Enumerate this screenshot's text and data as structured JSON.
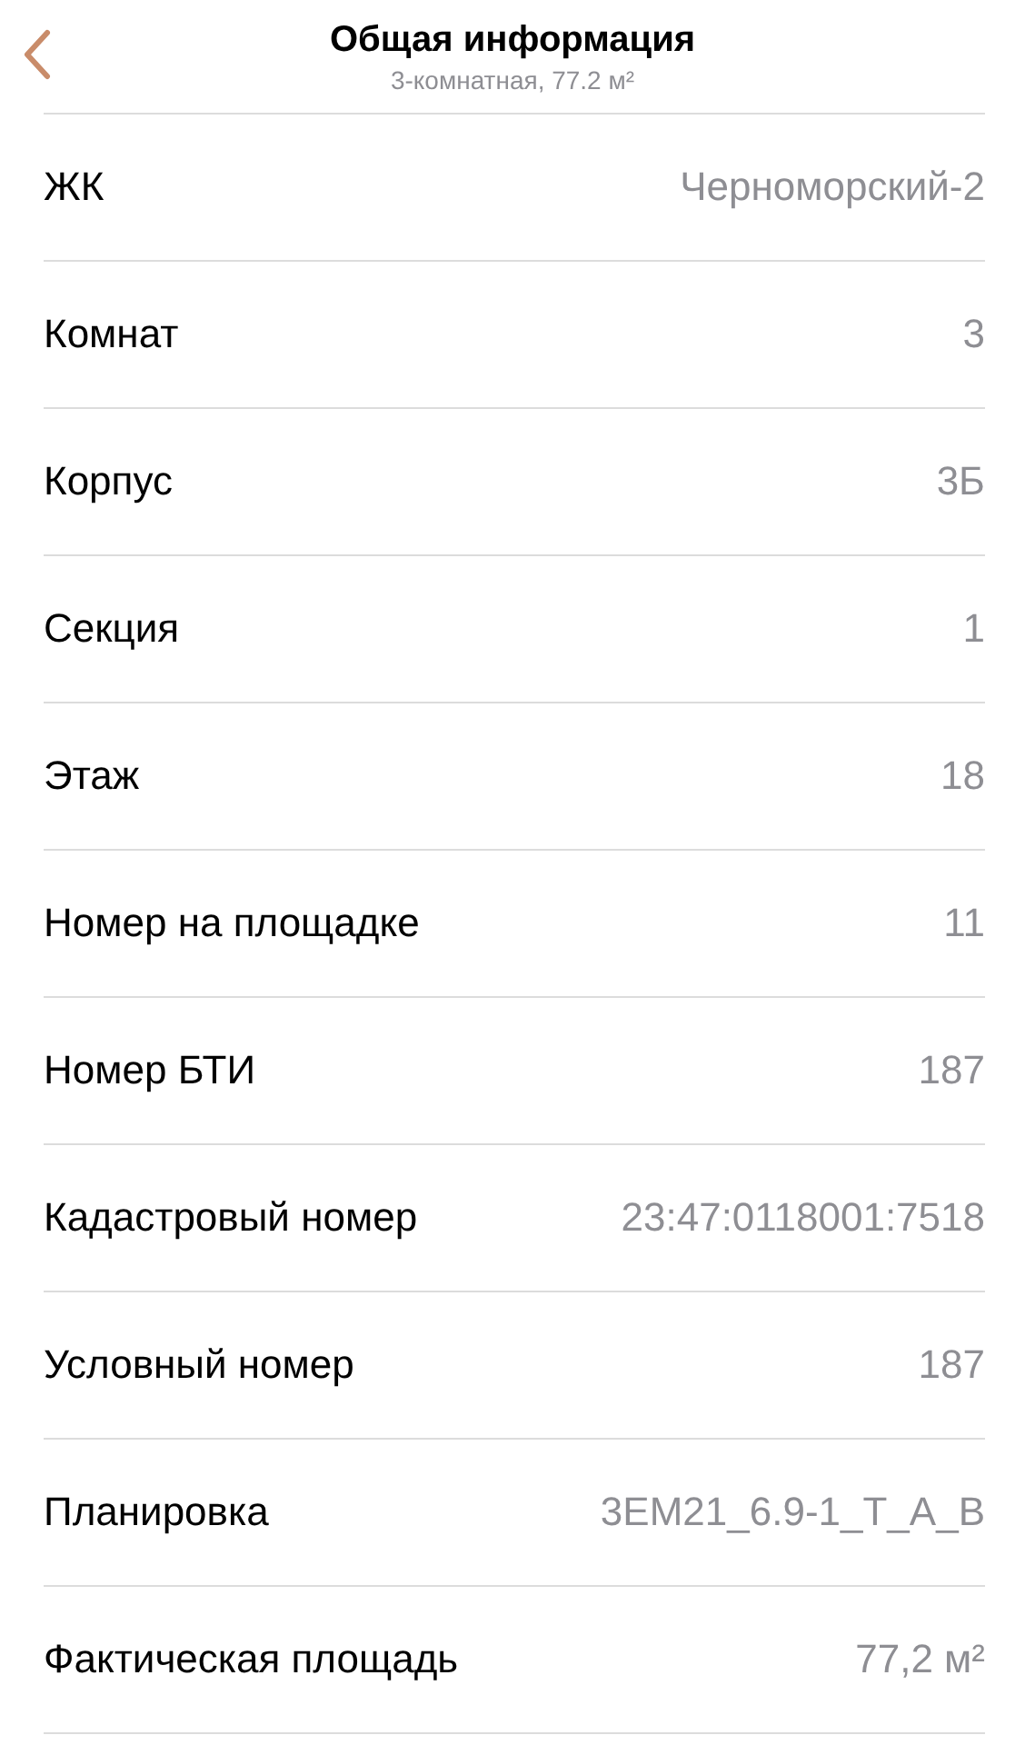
{
  "header": {
    "title": "Общая информация",
    "subtitle": "3-комнатная, 77.2 м²"
  },
  "rows": [
    {
      "label": "ЖК",
      "value": "Черноморский-2"
    },
    {
      "label": "Комнат",
      "value": "3"
    },
    {
      "label": "Корпус",
      "value": "3Б"
    },
    {
      "label": "Секция",
      "value": "1"
    },
    {
      "label": "Этаж",
      "value": "18"
    },
    {
      "label": "Номер на площадке",
      "value": "11"
    },
    {
      "label": "Номер БТИ",
      "value": "187"
    },
    {
      "label": "Кадастровый номер",
      "value": "23:47:0118001:7518"
    },
    {
      "label": "Условный номер",
      "value": "187"
    },
    {
      "label": "Планировка",
      "value": "3ЕМ21_6.9-1_Т_А_В"
    },
    {
      "label": "Фактическая площадь",
      "value": "77,2 м²"
    }
  ]
}
